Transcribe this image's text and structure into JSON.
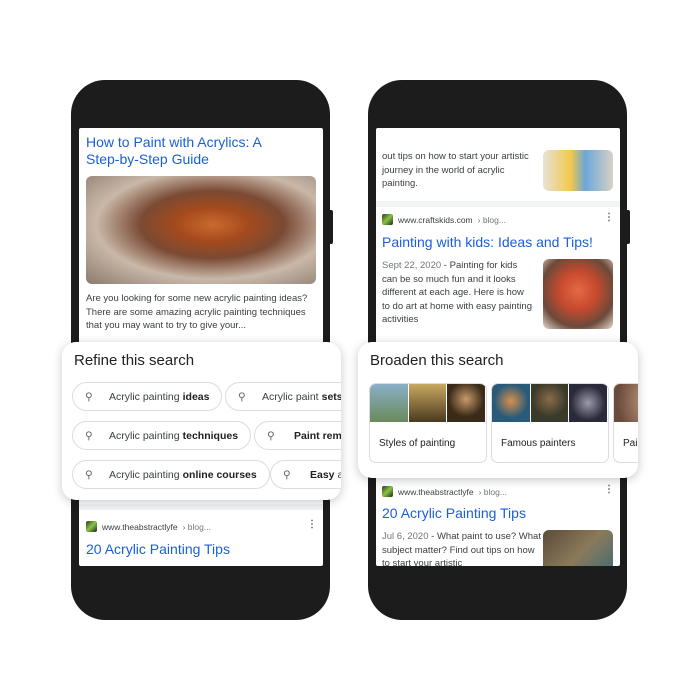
{
  "left_phone": {
    "result1": {
      "title": "How to Paint with Acrylics: A Step-by-Step Guide",
      "snippet": "Are you looking for some new acrylic painting ideas? There are some amazing acrylic painting techniques that you may want to try to give your..."
    },
    "refine": {
      "heading": "Refine this search",
      "chips": [
        {
          "prefix": "Acrylic painting",
          "bold": "ideas"
        },
        {
          "prefix": "Acrylic paint",
          "bold": "sets"
        },
        {
          "prefix": "Acrylic painting",
          "bold": "techniques"
        },
        {
          "prefix": "",
          "bold": "Paint remo"
        },
        {
          "prefix": "Acrylic painting",
          "bold": "online courses"
        },
        {
          "prefix": "",
          "bold": "Easy",
          "suffix": "ac"
        }
      ]
    },
    "result2": {
      "site": "www.theabstractlyfe",
      "path": "› blog...",
      "title": "20 Acrylic Painting Tips"
    }
  },
  "right_phone": {
    "result0": {
      "snippet": "out tips on how to start your artistic journey in the world of acrylic painting."
    },
    "result1": {
      "site": "www.craftskids.com",
      "path": "› blog...",
      "title": "Painting with kids: Ideas and Tips!",
      "date": "Sept 22, 2020",
      "snippet": "Painting for kids can be so much fun and it looks different at each age. Here is how to do art at home with easy painting activities"
    },
    "broaden": {
      "heading": "Broaden this search",
      "tiles": [
        "Styles of painting",
        "Famous painters",
        "Pai"
      ]
    },
    "result2": {
      "site": "www.theabstractlyfe",
      "path": "› blog...",
      "title": "20 Acrylic Painting Tips",
      "date": "Jul 6, 2020",
      "snippet": "What paint to use? What subject matter? Find out tips on how to start your artistic"
    }
  },
  "icons": {
    "search": "search-icon",
    "more": "more-vert-icon",
    "favicon": "site-favicon"
  },
  "colors": {
    "link": "#1a5fd8",
    "phone": "#1c1c1c"
  }
}
